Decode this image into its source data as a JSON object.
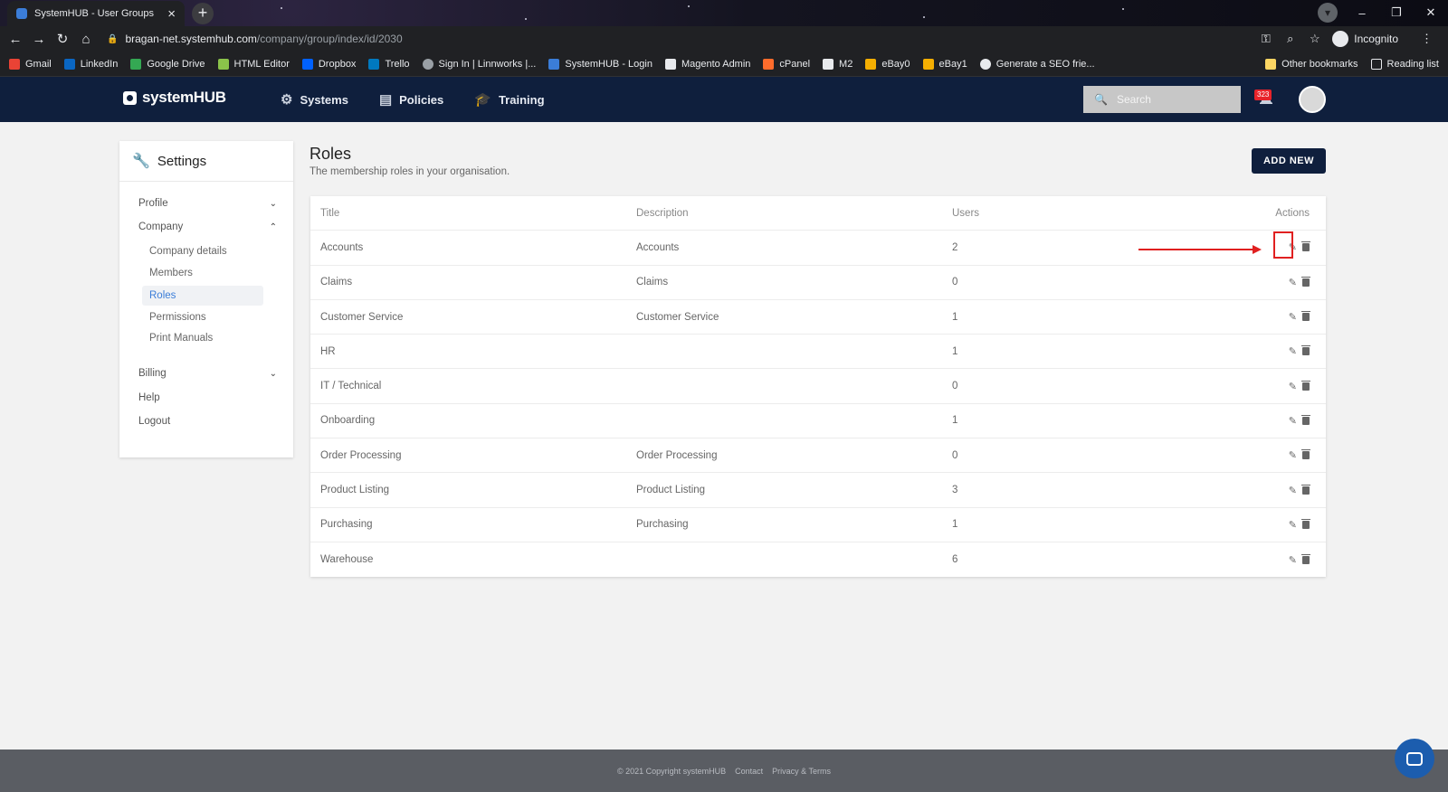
{
  "browser": {
    "tab_title": "SystemHUB - User Groups",
    "url_host": "bragan-net.systemhub.com",
    "url_path": "/company/group/index/id/2030",
    "profile_label": "Incognito",
    "bookmarks": [
      {
        "label": "Gmail",
        "color": "#ea4335"
      },
      {
        "label": "LinkedIn",
        "color": "#0a66c2"
      },
      {
        "label": "Google Drive",
        "color": "#34a853"
      },
      {
        "label": "HTML Editor",
        "color": "#8bc34a"
      },
      {
        "label": "Dropbox",
        "color": "#0061ff"
      },
      {
        "label": "Trello",
        "color": "#0079bf"
      },
      {
        "label": "Sign In | Linnworks |...",
        "color": "#9aa0a6"
      },
      {
        "label": "SystemHUB - Login",
        "color": "#3b7dd8"
      },
      {
        "label": "Magento Admin",
        "color": "#e8eaed"
      },
      {
        "label": "cPanel",
        "color": "#ff6c2c"
      },
      {
        "label": "M2",
        "color": "#e8eaed"
      },
      {
        "label": "eBay0",
        "color": "#f5af02"
      },
      {
        "label": "eBay1",
        "color": "#f5af02"
      },
      {
        "label": "Generate a SEO frie...",
        "color": "#e8eaed"
      }
    ],
    "other_bookmarks": "Other bookmarks",
    "reading_list": "Reading list"
  },
  "app": {
    "logo": "systemHUB",
    "nav": [
      {
        "label": "Systems",
        "icon": "gear-icon"
      },
      {
        "label": "Policies",
        "icon": "document-icon"
      },
      {
        "label": "Training",
        "icon": "graduation-cap-icon"
      }
    ],
    "search_placeholder": "Search",
    "notification_count": "323"
  },
  "sidebar": {
    "title": "Settings",
    "sections": {
      "profile": "Profile",
      "company": "Company",
      "billing": "Billing",
      "help": "Help",
      "logout": "Logout"
    },
    "company_items": [
      "Company details",
      "Members",
      "Roles",
      "Permissions",
      "Print Manuals"
    ],
    "active_item": "Roles"
  },
  "main": {
    "title": "Roles",
    "subtitle": "The membership roles in your organisation.",
    "add_button": "ADD NEW",
    "columns": {
      "title": "Title",
      "description": "Description",
      "users": "Users",
      "actions": "Actions"
    },
    "rows": [
      {
        "title": "Accounts",
        "description": "Accounts",
        "users": "2"
      },
      {
        "title": "Claims",
        "description": "Claims",
        "users": "0"
      },
      {
        "title": "Customer Service",
        "description": "Customer Service",
        "users": "1"
      },
      {
        "title": "HR",
        "description": "",
        "users": "1"
      },
      {
        "title": "IT / Technical",
        "description": "",
        "users": "0"
      },
      {
        "title": "Onboarding",
        "description": "",
        "users": "1"
      },
      {
        "title": "Order Processing",
        "description": "Order Processing",
        "users": "0"
      },
      {
        "title": "Product Listing",
        "description": "Product Listing",
        "users": "3"
      },
      {
        "title": "Purchasing",
        "description": "Purchasing",
        "users": "1"
      },
      {
        "title": "Warehouse",
        "description": "",
        "users": "6"
      }
    ]
  },
  "footer": {
    "copyright": "© 2021 Copyright systemHUB",
    "contact": "Contact",
    "privacy": "Privacy & Terms"
  },
  "colors": {
    "header_bg": "#0f1f3d",
    "accent_blue": "#3b7dd8",
    "annotation_red": "#e02020",
    "footer_bg": "#5a5d63"
  }
}
